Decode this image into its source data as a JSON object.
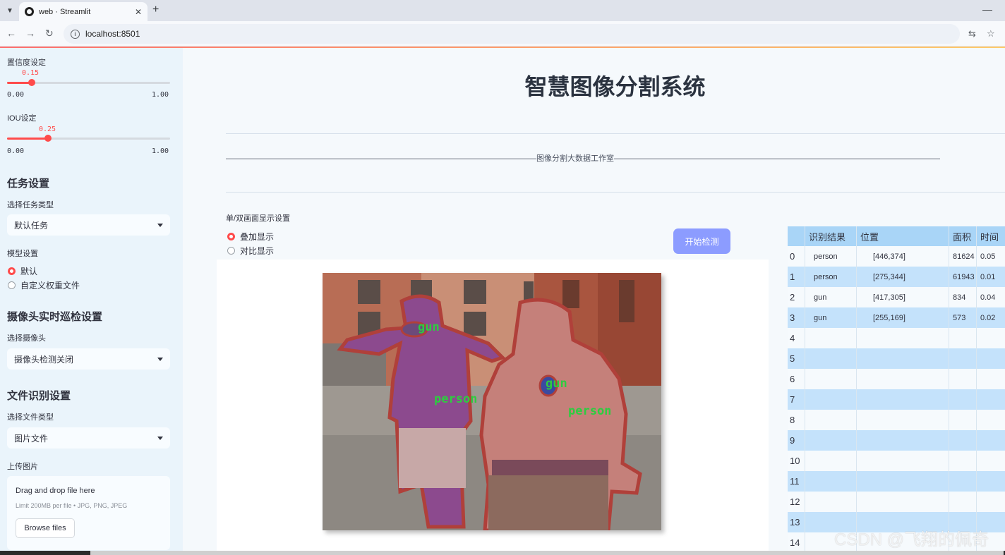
{
  "browser": {
    "tab_title": "web · Streamlit",
    "url": "localhost:8501"
  },
  "sidebar": {
    "confidence": {
      "label": "置信度设定",
      "value": "0.15",
      "min": "0.00",
      "max": "1.00",
      "fraction": 0.15
    },
    "iou": {
      "label": "IOU设定",
      "value": "0.25",
      "min": "0.00",
      "max": "1.00",
      "fraction": 0.25
    },
    "task_heading": "任务设置",
    "task_type_label": "选择任务类型",
    "task_type_value": "默认任务",
    "model_label": "模型设置",
    "model_options": [
      "默认",
      "自定义权重文件"
    ],
    "camera_heading": "摄像头实时巡检设置",
    "camera_label": "选择摄像头",
    "camera_value": "摄像头检测关闭",
    "file_heading": "文件识别设置",
    "file_type_label": "选择文件类型",
    "file_type_value": "图片文件",
    "upload_label": "上传图片",
    "upload": {
      "title": "Drag and drop file here",
      "limit": "Limit 200MB per file • JPG, PNG, JPEG",
      "button": "Browse files"
    }
  },
  "main": {
    "title": "智慧图像分割系统",
    "subtitle": "图像分割大数据工作室",
    "display_mode_label": "单/双画面显示设置",
    "display_modes": [
      "叠加显示",
      "对比显示"
    ],
    "start_button": "开始检测",
    "detections": [
      "gun",
      "person",
      "gun",
      "person"
    ]
  },
  "table": {
    "columns": [
      "识别结果",
      "位置",
      "面积",
      "时间"
    ],
    "rows": [
      {
        "idx": "0",
        "cls": "person",
        "pos": "[446,374]",
        "area": "81624",
        "time": "0.05"
      },
      {
        "idx": "1",
        "cls": "person",
        "pos": "[275,344]",
        "area": "61943",
        "time": "0.01"
      },
      {
        "idx": "2",
        "cls": "gun",
        "pos": "[417,305]",
        "area": "834",
        "time": "0.04"
      },
      {
        "idx": "3",
        "cls": "gun",
        "pos": "[255,169]",
        "area": "573",
        "time": "0.02"
      }
    ],
    "empty_rows": [
      "4",
      "5",
      "6",
      "7",
      "8",
      "9",
      "10",
      "11",
      "12",
      "13",
      "14"
    ]
  },
  "watermark": "CSDN @飞翔的佩奇",
  "colors": {
    "accent": "#ff4b4b",
    "button": "#8c9cff",
    "table_header": "#a9d5f7",
    "mask_outline": "#b0403a",
    "label_text": "#2ecc40"
  }
}
